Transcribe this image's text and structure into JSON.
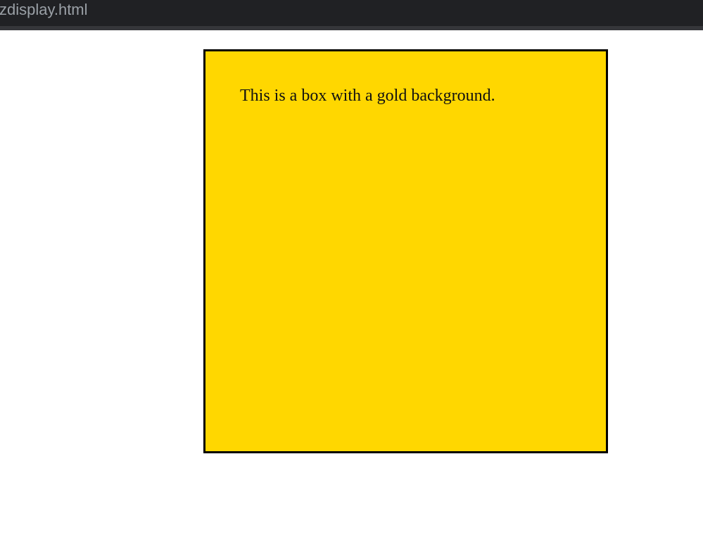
{
  "tab": {
    "title": "zdisplay.html"
  },
  "page": {
    "box": {
      "text": "This is a box with a gold background.",
      "background_color": "#ffd700",
      "border_color": "#000000"
    }
  },
  "colors": {
    "tabbar_background": "#202124",
    "tab_title_text": "#9aa0a6",
    "page_background": "#ffffff"
  }
}
